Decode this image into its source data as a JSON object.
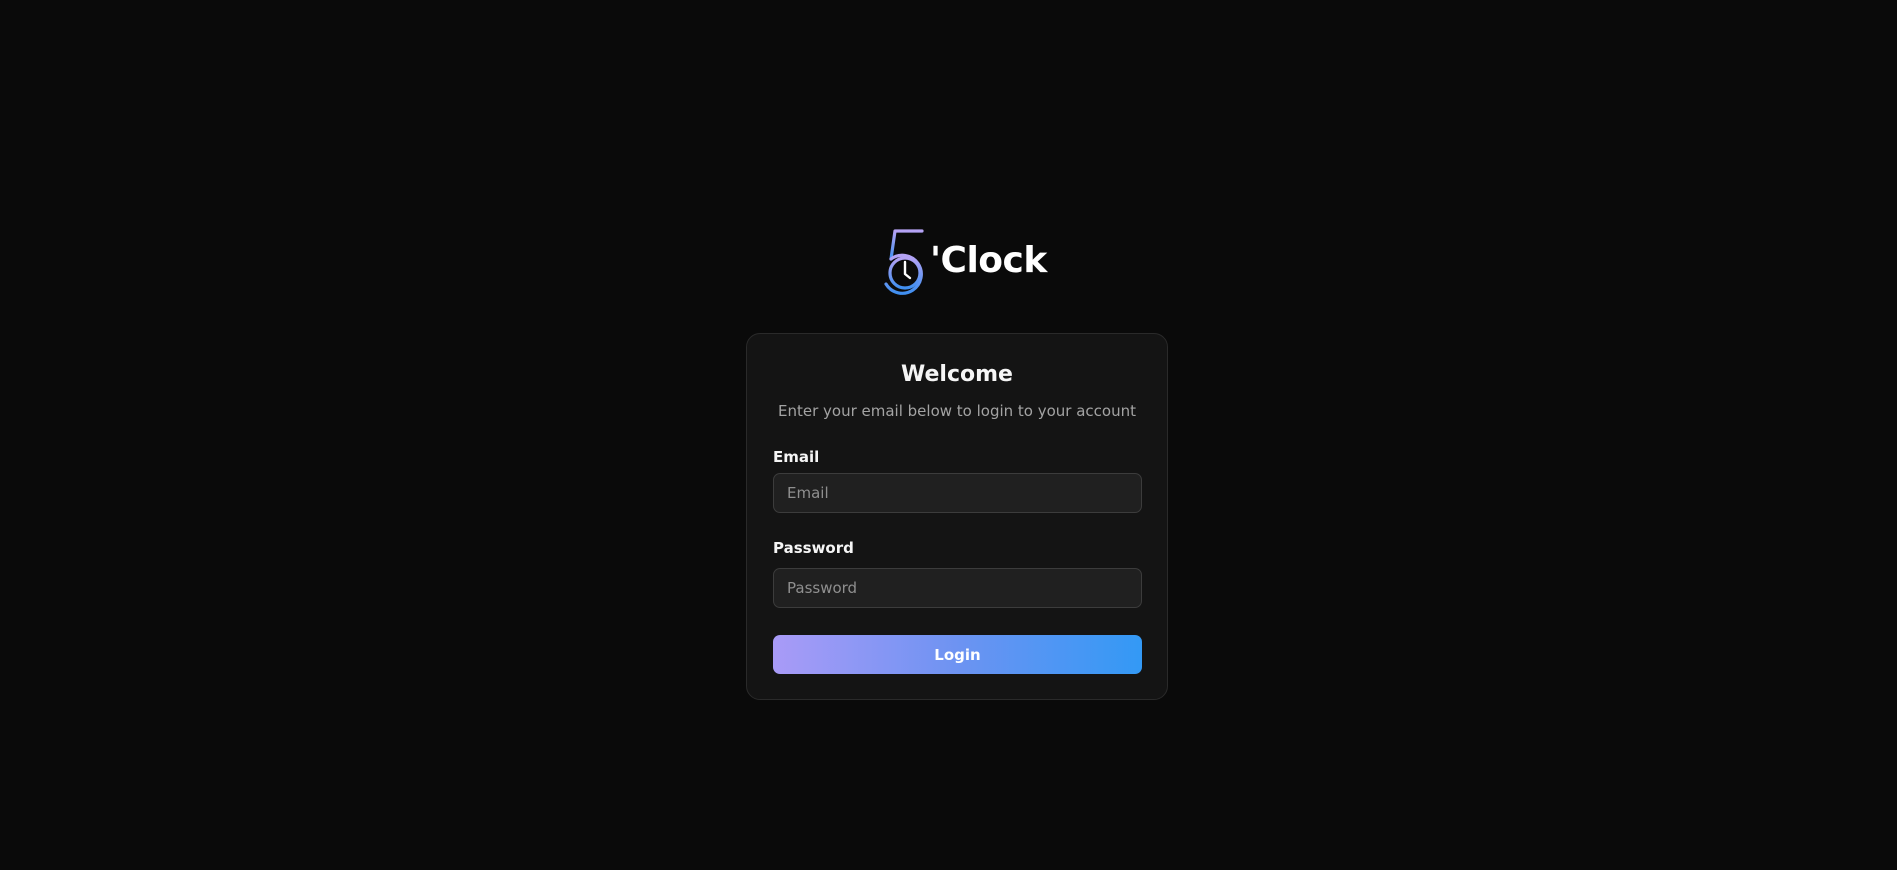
{
  "brand": {
    "logo_mark": "5",
    "logo_word": "'Clock",
    "gradient_start": "#a99bf7",
    "gradient_end": "#3399f5"
  },
  "login_card": {
    "title": "Welcome",
    "subtitle": "Enter your email below to login to your account",
    "email": {
      "label": "Email",
      "placeholder": "Email",
      "value": ""
    },
    "password": {
      "label": "Password",
      "placeholder": "Password",
      "value": ""
    },
    "login_button": "Login"
  }
}
